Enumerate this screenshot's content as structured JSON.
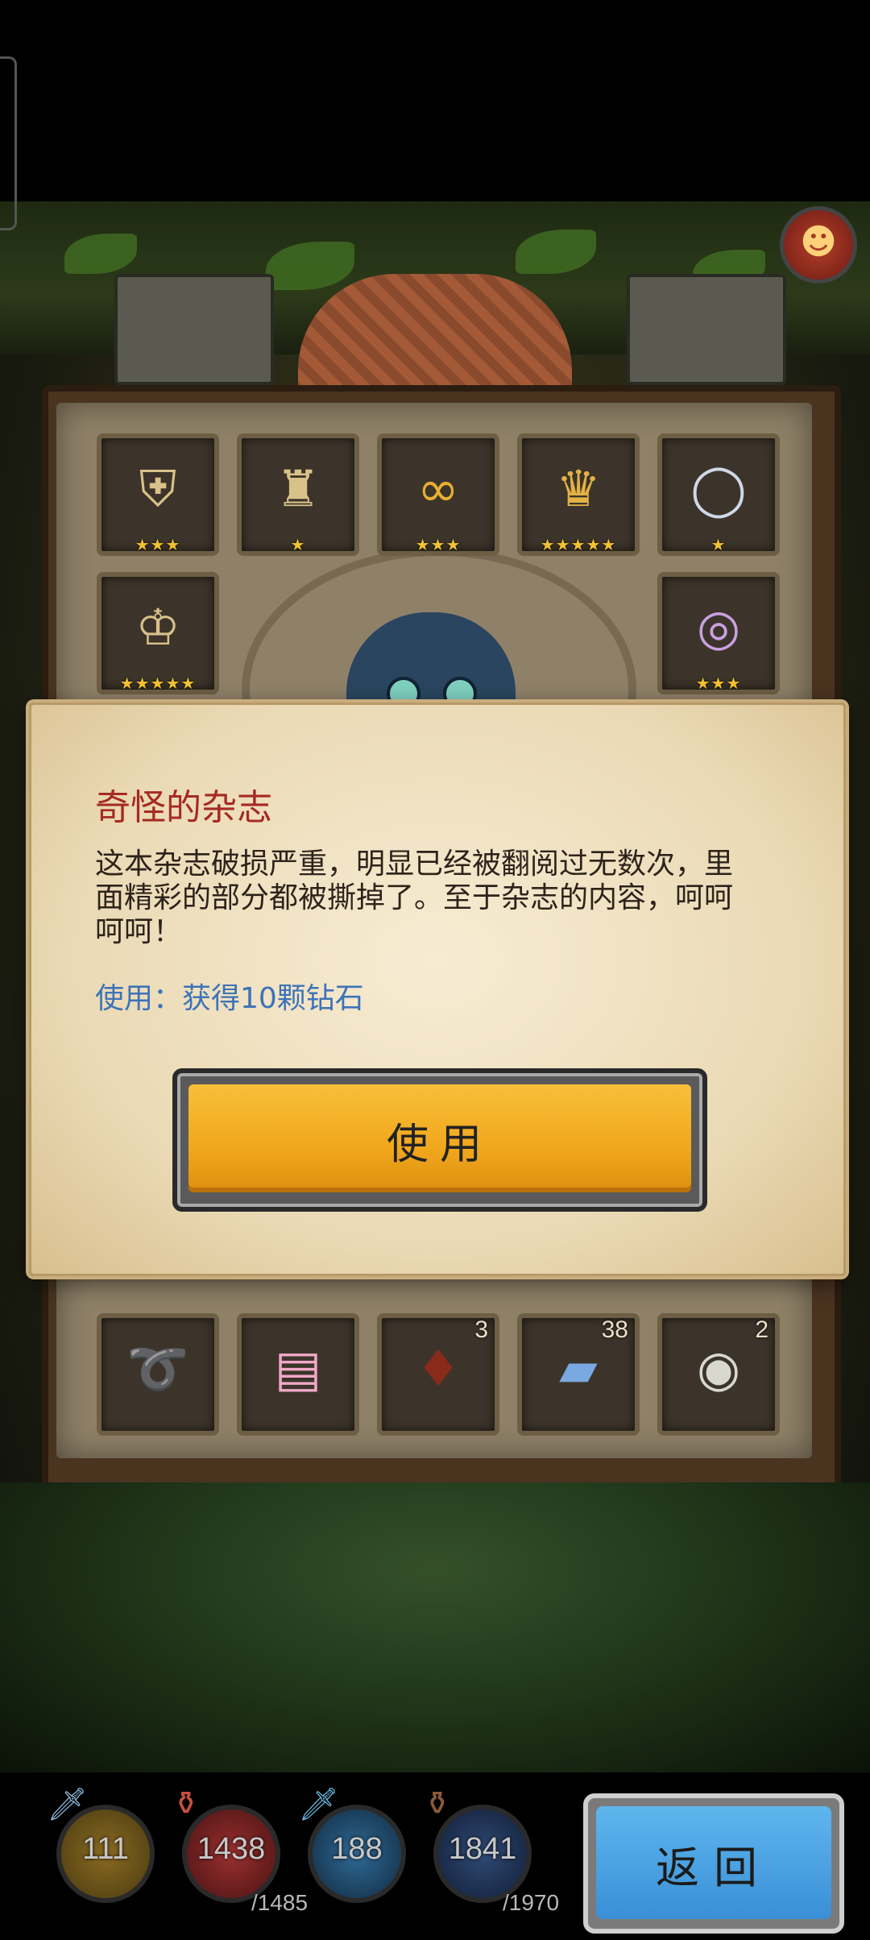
{
  "top_badge": {
    "icon": "skull-icon"
  },
  "inventory": {
    "row1": [
      {
        "icon": "armor-tunic-icon",
        "stars": "★★★"
      },
      {
        "icon": "chest-armor-icon",
        "stars": "★"
      },
      {
        "icon": "gold-bracer-icon",
        "stars": "★★★"
      },
      {
        "icon": "lantern-icon",
        "stars": "★★★★★"
      },
      {
        "icon": "ring-icon",
        "stars": "★"
      }
    ],
    "row2": [
      {
        "icon": "crown-belt-icon",
        "stars": "★★★★★"
      },
      {
        "icon": "jeweled-ring-icon",
        "stars": "★★★"
      }
    ],
    "bottom_row": [
      {
        "icon": "whip-icon",
        "count": ""
      },
      {
        "icon": "magazine-icon",
        "count": ""
      },
      {
        "icon": "wine-bottle-icon",
        "count": "3"
      },
      {
        "icon": "cigarette-pack-icon",
        "count": "38"
      },
      {
        "icon": "eyeball-icon",
        "count": "2"
      }
    ]
  },
  "dialog": {
    "title": "奇怪的杂志",
    "description": "这本杂志破损严重，明显已经被翻阅过无数次，里面精彩的部分都被撕掉了。至于杂志的内容，呵呵呵呵！",
    "use_effect": "使用：获得10颗钻石",
    "use_button": "使用"
  },
  "stats": [
    {
      "icon": "sword-icon",
      "value": "111",
      "max": "",
      "color": "#6b5418"
    },
    {
      "icon": "health-potion-icon",
      "value": "1438",
      "max": "/1485",
      "color": "#7a2222"
    },
    {
      "icon": "mana-sword-icon",
      "value": "188",
      "max": "",
      "color": "#1f4a6a"
    },
    {
      "icon": "mana-potion-icon",
      "value": "1841",
      "max": "/1970",
      "color": "#243a5a"
    }
  ],
  "back_button": "返回"
}
